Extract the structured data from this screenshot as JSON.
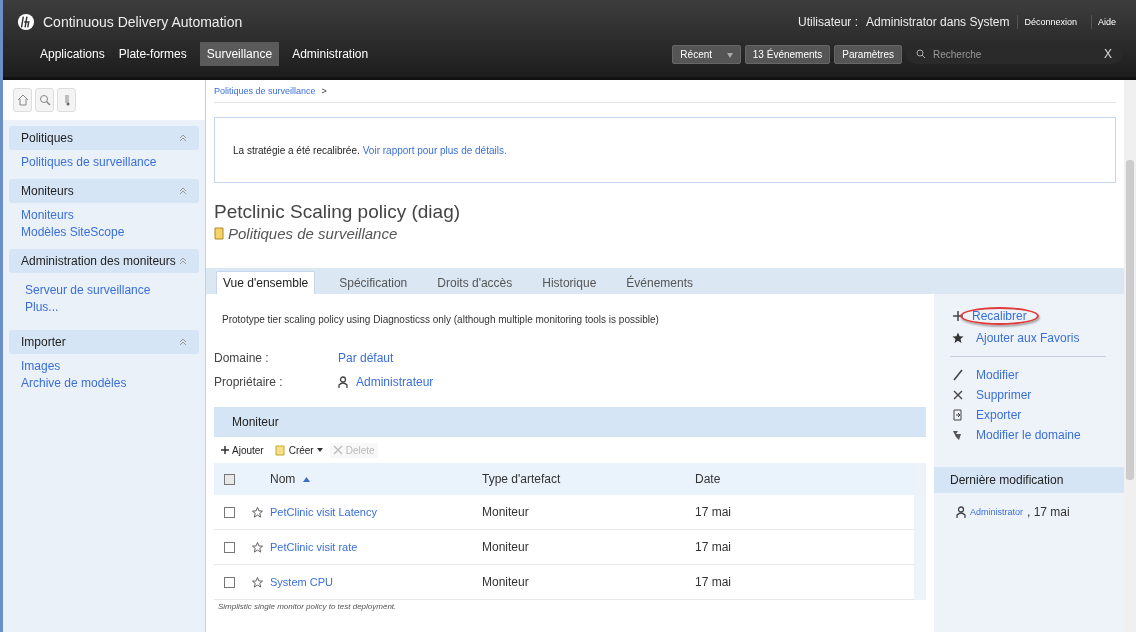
{
  "header": {
    "app_title": "Continuous Delivery Automation",
    "user_label": "Utilisateur :",
    "user_value": "Administrator dans System",
    "links": [
      "Déconnexion",
      "Aide"
    ],
    "nav_tabs": [
      {
        "label": "Applications",
        "selected": false
      },
      {
        "label": "Plate-formes",
        "selected": false
      },
      {
        "label": "Surveillance",
        "selected": true
      },
      {
        "label": "Administration",
        "selected": false
      }
    ],
    "recent": "Récent",
    "events": "13 Événements",
    "settings": "Paramètres",
    "search": {
      "placeholder": "Recherche"
    },
    "clear": "X"
  },
  "sidebar": {
    "sections": [
      {
        "title": "Politiques",
        "expanded": true,
        "items": [
          "Politiques de surveillance"
        ]
      },
      {
        "title": "Moniteurs",
        "expanded": true,
        "items": [
          "Moniteurs",
          "Modèles SiteScope"
        ]
      },
      {
        "title": "Administration des moniteurs",
        "expanded": true,
        "items": [
          "Serveur de surveillance",
          "Plus..."
        ]
      },
      {
        "title": "Importer",
        "expanded": true,
        "items": [
          "Images",
          "Archive de modèles"
        ]
      }
    ]
  },
  "breadcrumb": {
    "link": "Politiques de surveillance",
    "separator": ">"
  },
  "notice": {
    "text": "La stratégie a été recalibrée.",
    "link": "Voir rapport pour plus de détails."
  },
  "title": "Petclinic Scaling policy (diag)",
  "subtitle": "Politiques de surveillance",
  "tabs": [
    {
      "label": "Vue d'ensemble",
      "selected": true
    },
    {
      "label": "Spécification",
      "selected": false
    },
    {
      "label": "Droits d'accès",
      "selected": false
    },
    {
      "label": "Historique",
      "selected": false
    },
    {
      "label": "Événements",
      "selected": false
    }
  ],
  "description": "Prototype tier scaling policy using Diagnosticss only (although multiple monitoring tools is possible)",
  "fields": [
    {
      "label": "Domaine :",
      "value": "Par défaut",
      "kind": "link"
    },
    {
      "label": "Propriétaire :",
      "value": "Administrateur",
      "kind": "user"
    }
  ],
  "monitor": {
    "title": "Moniteur",
    "toolbar": [
      {
        "label": "Ajouter",
        "kind": "add",
        "disabled": false
      },
      {
        "label": "Créer",
        "kind": "create",
        "disabled": false
      },
      {
        "label": "Delete",
        "kind": "delete",
        "disabled": true
      }
    ],
    "select_all_checked": false,
    "columns": [
      "Nom",
      "Type d'artefact",
      "Date"
    ],
    "rows": [
      {
        "name": "PetClinic visit Latency",
        "type": "Moniteur",
        "date": "17 mai",
        "checked": false
      },
      {
        "name": "PetClinic visit rate",
        "type": "Moniteur",
        "date": "17 mai",
        "checked": false
      },
      {
        "name": "System CPU",
        "type": "Moniteur",
        "date": "17 mai",
        "checked": false
      }
    ],
    "note": "Simplistic single monitor policy to test deployment."
  },
  "actions": [
    {
      "label": "Recalibrer",
      "kind": "recalibrate",
      "highlighted": true
    },
    {
      "label": "Ajouter aux Favoris",
      "kind": "favorite",
      "highlighted": false
    },
    {
      "kind": "separator"
    },
    {
      "label": "Modifier",
      "kind": "edit",
      "highlighted": false
    },
    {
      "label": "Supprimer",
      "kind": "delete",
      "highlighted": false
    },
    {
      "label": "Exporter",
      "kind": "export",
      "highlighted": false
    },
    {
      "label": "Modifier le domaine",
      "kind": "domain",
      "highlighted": false
    }
  ],
  "last_modified": {
    "title": "Dernière modification",
    "user": "Administrator",
    "date": ", 17 mai"
  }
}
